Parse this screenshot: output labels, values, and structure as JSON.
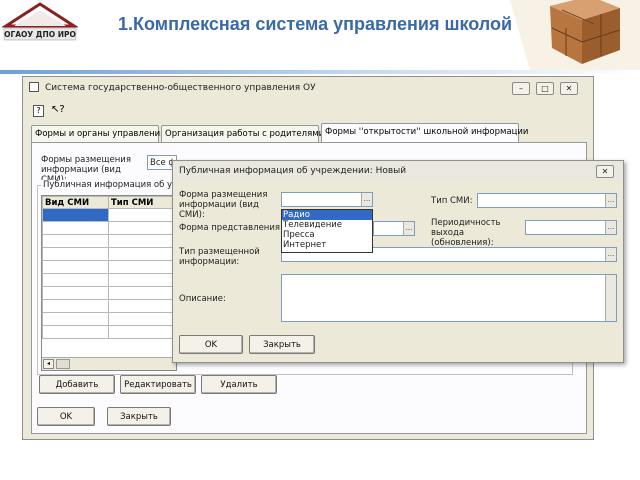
{
  "slide": {
    "title": "1.Комплексная система управления школой",
    "logo_text": "ОГАОУ ДПО ИРО"
  },
  "main_window": {
    "title": "Система государственно-общественного управления ОУ",
    "tabs": [
      "Формы и органы управления",
      "Организация работы с родителями",
      "Формы ''открытости'' школьной информации"
    ],
    "forms_label": "Формы размещения информации (вид СМИ):",
    "forms_value": "Все ф",
    "group_label": "Публичная информация об учреж",
    "grid_headers": [
      "Вид СМИ",
      "Тип СМИ"
    ],
    "buttons": {
      "add": "Добавить",
      "edit": "Редактировать",
      "delete": "Удалить",
      "ok": "OK",
      "close": "Закрыть"
    }
  },
  "dialog": {
    "title": "Публичная информация об учреждении: Новый",
    "labels": {
      "form_placement": "Форма размещения информации (вид СМИ):",
      "form_presentation": "Форма представления:",
      "type_info": "Тип размещенной информации:",
      "description": "Описание:",
      "media_type": "Тип СМИ:",
      "periodicity": "Периодичность выхода (обновления):"
    },
    "dropdown_options": [
      "Радио",
      "Телевидение",
      "Пресса",
      "Интернет"
    ],
    "selected_option": "Радио",
    "buttons": {
      "ok": "OK",
      "close": "Закрыть"
    }
  },
  "colors": {
    "title": "#3a6aa6",
    "window_bg": "#ece9d8",
    "selection": "#316ac5"
  }
}
